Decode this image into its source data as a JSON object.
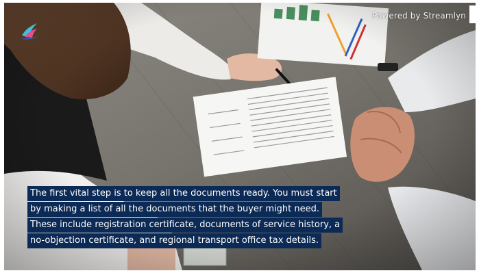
{
  "watermark": {
    "text": "Powered by Streamlyn"
  },
  "logo": {
    "icon": "streamlyn-logo-icon",
    "colors": {
      "teal": "#3fc0d8",
      "pink": "#e4508c",
      "blue": "#2a62c9"
    }
  },
  "caption": {
    "lines": [
      "The first vital step is to keep all the documents ready. You must start",
      "by making a list of all the documents that the buyer might need.",
      "These include registration certificate, documents of service history, a",
      "no-objection certificate, and regional transport office tax details."
    ],
    "background_color": "#0b2a55",
    "text_color": "#ffffff"
  }
}
